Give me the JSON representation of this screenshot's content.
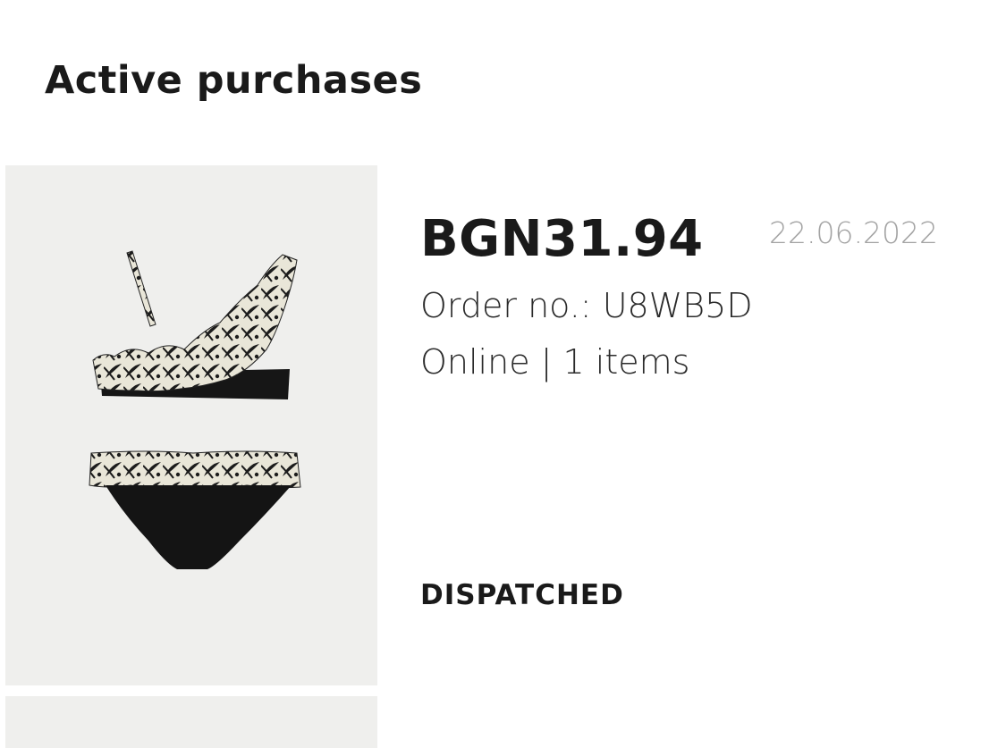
{
  "header": {
    "title": "Active purchases"
  },
  "orders": [
    {
      "price": "BGN31.94",
      "date": "22.06.2022",
      "order_no": "Order no.: U8WB5D",
      "channel_items": "Online | 1 items",
      "status": "DISPATCHED",
      "product_image": "bikini-product-photo"
    }
  ]
}
